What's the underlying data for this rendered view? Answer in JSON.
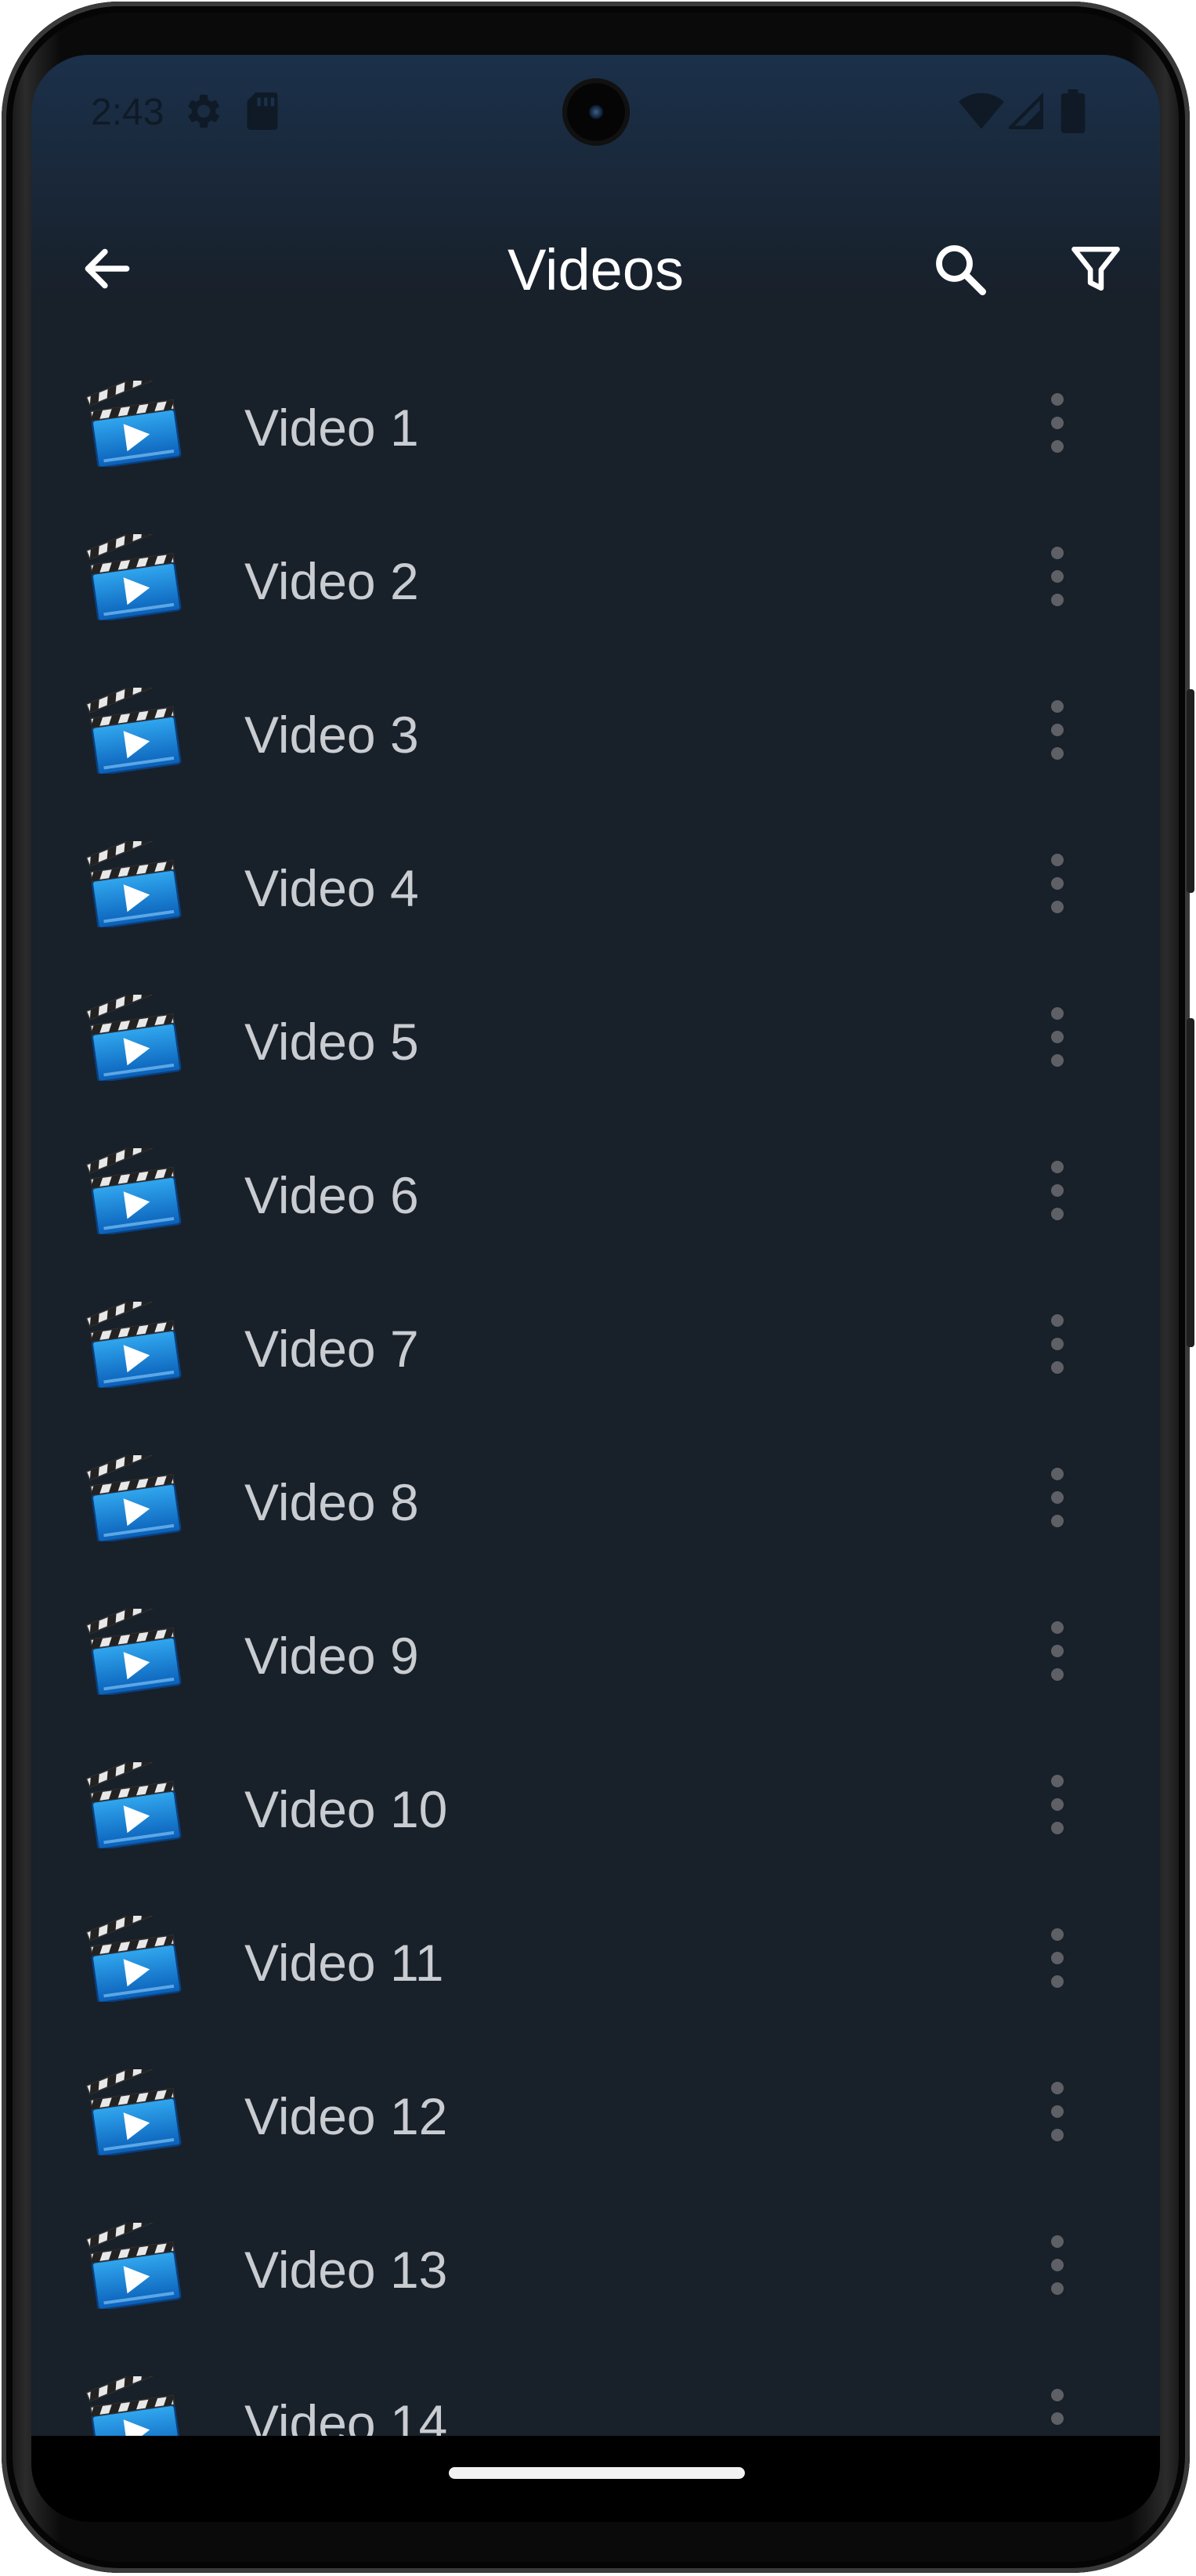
{
  "status_bar": {
    "time": "2:43",
    "icons": [
      "settings-gear-icon",
      "sd-card-icon",
      "wifi-icon",
      "cell-signal-icon",
      "battery-icon"
    ]
  },
  "toolbar": {
    "title": "Videos",
    "back_icon": "arrow-back-icon",
    "search_icon": "search-icon",
    "filter_icon": "filter-icon"
  },
  "videos": [
    {
      "label": "Video 1"
    },
    {
      "label": "Video 2"
    },
    {
      "label": "Video 3"
    },
    {
      "label": "Video 4"
    },
    {
      "label": "Video 5"
    },
    {
      "label": "Video 6"
    },
    {
      "label": "Video 7"
    },
    {
      "label": "Video 8"
    },
    {
      "label": "Video 9"
    },
    {
      "label": "Video 10"
    },
    {
      "label": "Video 11"
    },
    {
      "label": "Video 12"
    },
    {
      "label": "Video 13"
    },
    {
      "label": "Video 14"
    }
  ],
  "colors": {
    "background": "#18202a",
    "header_gradient_top": "#1b304a",
    "title_text": "#ffffff",
    "item_text": "#c9ccd0",
    "menu_dots": "#5e6066"
  }
}
